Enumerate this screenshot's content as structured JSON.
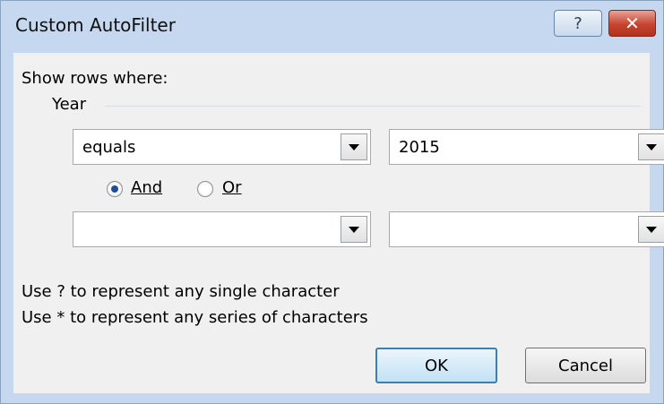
{
  "window": {
    "title": "Custom AutoFilter",
    "help_label": "?",
    "close_label": "✕"
  },
  "form": {
    "show_rows_label": "Show rows where:",
    "field_name": "Year",
    "criteria1": {
      "operator": "equals",
      "value": "2015"
    },
    "logic": {
      "and_label": "And",
      "or_label": "Or",
      "selected": "And"
    },
    "criteria2": {
      "operator": "",
      "value": ""
    }
  },
  "hints": {
    "single_char": "Use ? to represent any single character",
    "series_chars": "Use * to represent any series of characters"
  },
  "buttons": {
    "ok_label": "OK",
    "cancel_label": "Cancel"
  },
  "colors": {
    "frame": "#c5d8ef",
    "client": "#f0f0f0",
    "close": "#c6442f",
    "radio_dot": "#1f4e9e"
  }
}
